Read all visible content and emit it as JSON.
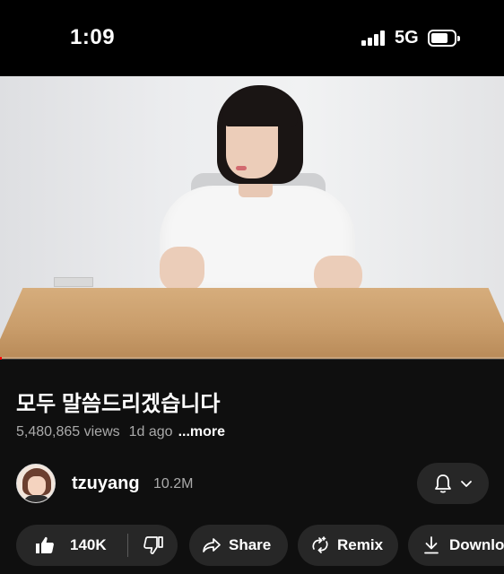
{
  "status_bar": {
    "time": "1:09",
    "network": "5G",
    "signal_bars": 4,
    "battery_level": 0.8
  },
  "video": {
    "playback_progress": 0.004,
    "progress_color": "#ff0000"
  },
  "title": "모두 말씀드리겠습니다",
  "meta": {
    "views": "5,480,865 views",
    "age": "1d ago",
    "more": "...more"
  },
  "channel": {
    "name": "tzuyang",
    "subscribers": "10.2M",
    "bell_icon": "bell-icon",
    "chevron_icon": "chevron-down-icon"
  },
  "actions": {
    "likes": "140K",
    "share": "Share",
    "remix": "Remix",
    "download": "Download"
  },
  "colors": {
    "background": "#0f0f0f",
    "pill": "#272727",
    "secondary_text": "#aaaaaa"
  }
}
